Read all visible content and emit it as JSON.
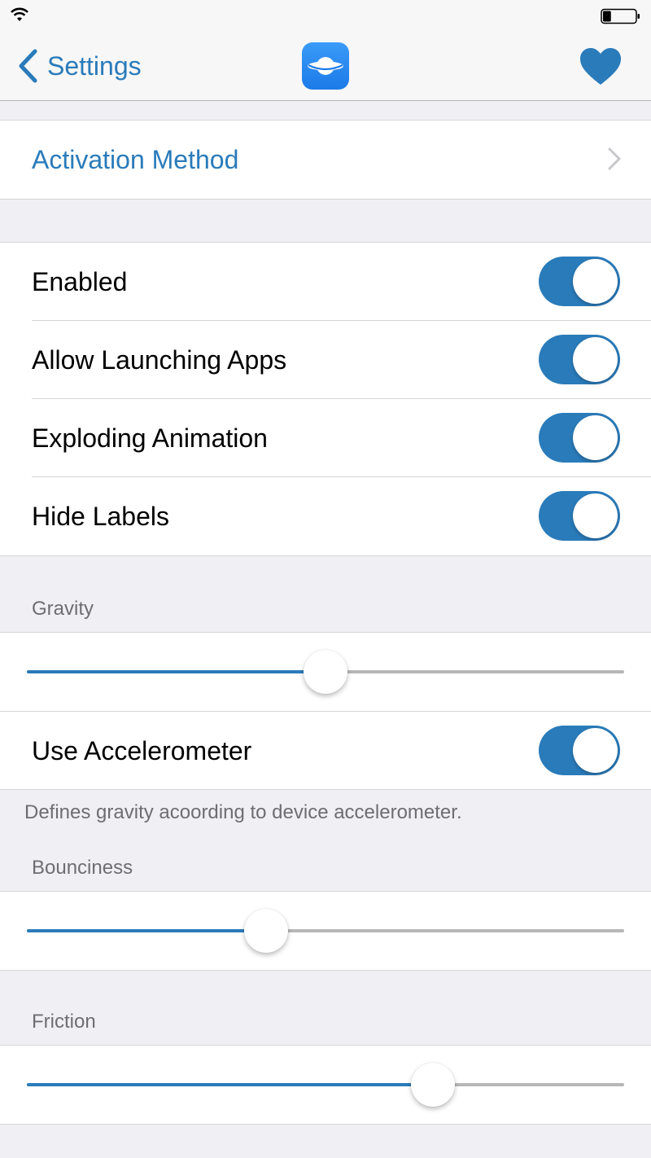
{
  "status_bar": {
    "wifi_icon": "wifi-icon",
    "battery_icon": "battery-icon",
    "battery_level": 0.25
  },
  "nav": {
    "back_label": "Settings",
    "app_icon": "planet-app-icon",
    "heart_icon": "heart-icon",
    "tint": "#2a7bba"
  },
  "activation": {
    "label": "Activation Method"
  },
  "toggles": [
    {
      "label": "Enabled",
      "on": true
    },
    {
      "label": "Allow Launching Apps",
      "on": true
    },
    {
      "label": "Exploding Animation",
      "on": true
    },
    {
      "label": "Hide Labels",
      "on": true
    }
  ],
  "gravity": {
    "header": "Gravity",
    "value": 0.5,
    "accelerometer": {
      "label": "Use Accelerometer",
      "on": true
    },
    "footer": "Defines gravity acoording to device accelerometer."
  },
  "bounciness": {
    "header": "Bounciness",
    "value": 0.4
  },
  "friction": {
    "header": "Friction",
    "value": 0.68
  }
}
